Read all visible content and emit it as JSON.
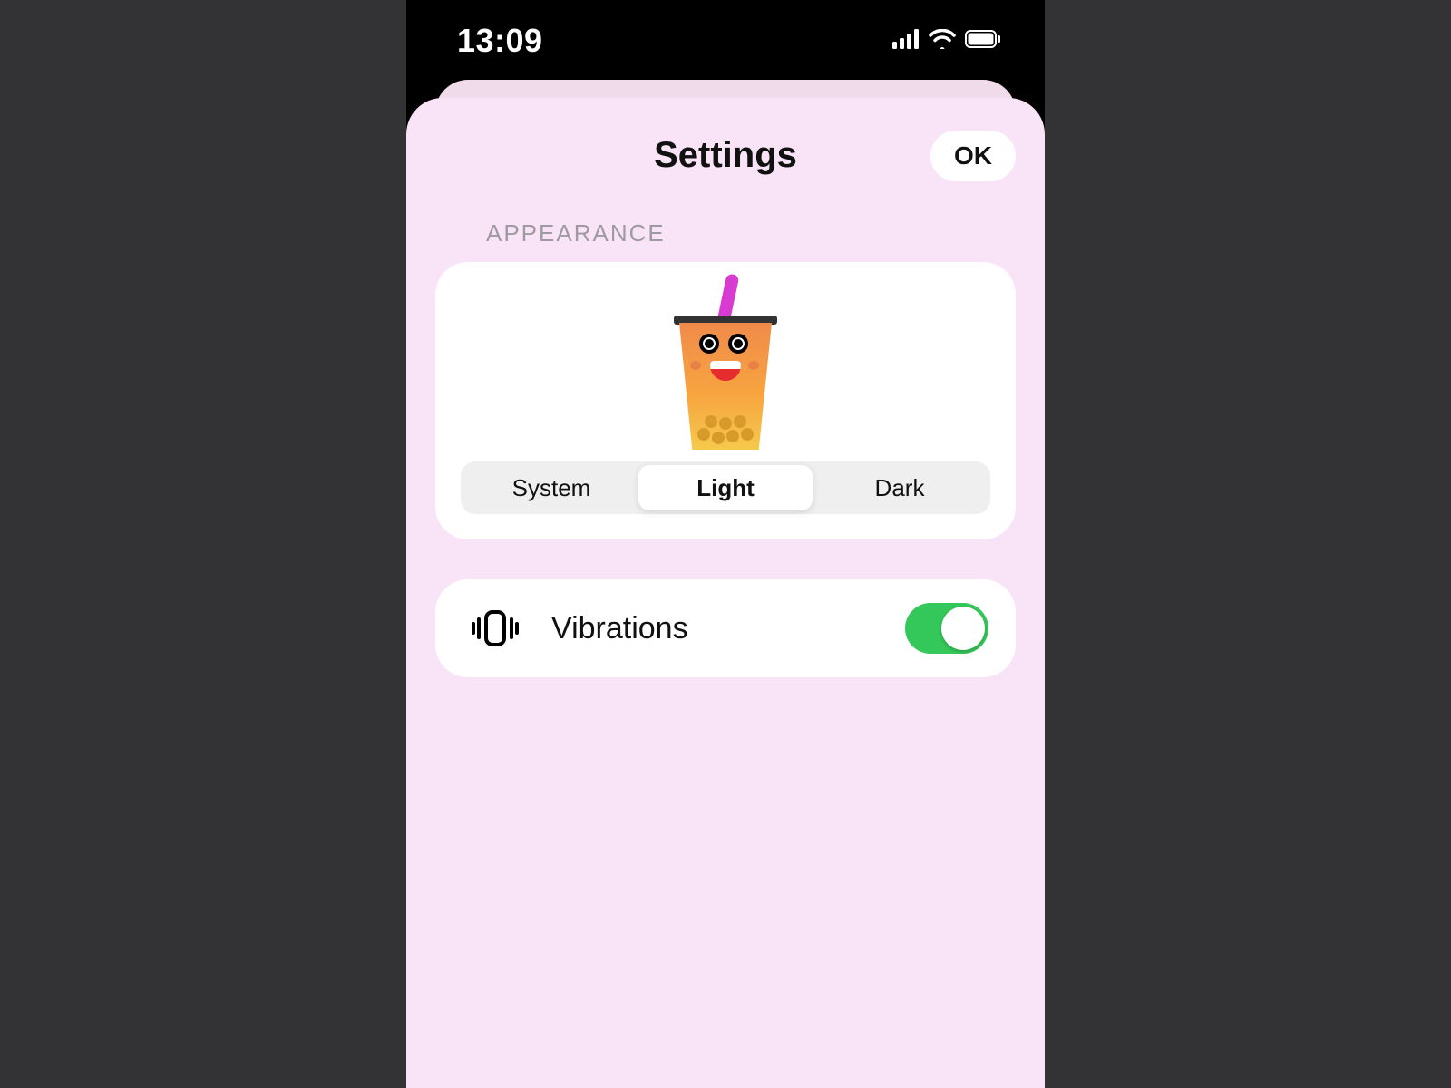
{
  "status": {
    "time": "13:09"
  },
  "sheet": {
    "title": "Settings",
    "ok_label": "OK"
  },
  "appearance": {
    "section_label": "APPEARANCE",
    "options": {
      "system": "System",
      "light": "Light",
      "dark": "Dark"
    },
    "selected": "Light"
  },
  "vibrations": {
    "label": "Vibrations",
    "enabled": true
  },
  "colors": {
    "switch_on": "#34c759",
    "sheet_bg": "#f9e4f7"
  }
}
